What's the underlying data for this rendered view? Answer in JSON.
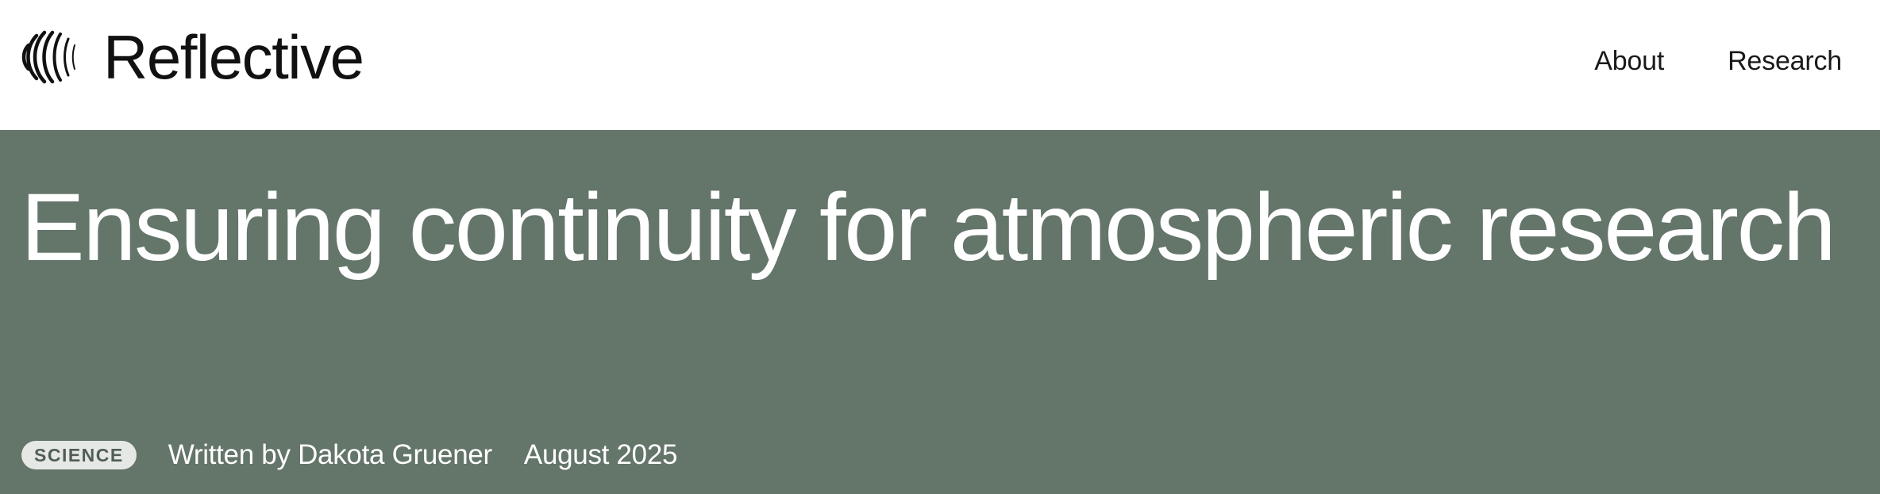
{
  "header": {
    "brand": {
      "name": "Reflective",
      "icon": "concentric-arcs-logo-icon"
    },
    "nav": [
      {
        "label": "About"
      },
      {
        "label": "Research"
      }
    ]
  },
  "hero": {
    "background_color": "#64756a",
    "title": "Ensuring continuity for atmospheric research",
    "tag": "SCIENCE",
    "byline": "Written by Dakota Gruener",
    "date": "August 2025"
  }
}
